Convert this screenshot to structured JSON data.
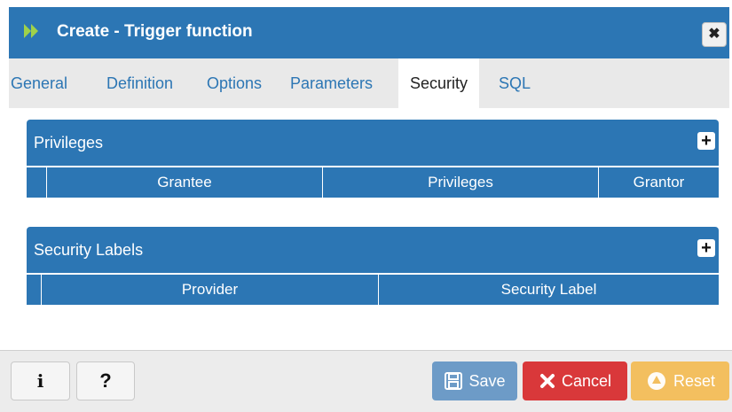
{
  "dialog": {
    "title": "Create - Trigger function",
    "close_symbol": "✖"
  },
  "tabs": [
    {
      "label": "General"
    },
    {
      "label": "Definition"
    },
    {
      "label": "Options"
    },
    {
      "label": "Parameters"
    },
    {
      "label": "Security"
    },
    {
      "label": "SQL"
    }
  ],
  "active_tab": "Security",
  "privileges": {
    "title": "Privileges",
    "add_symbol": "+",
    "columns": [
      "Grantee",
      "Privileges",
      "Grantor"
    ]
  },
  "security_labels": {
    "title": "Security Labels",
    "add_symbol": "+",
    "columns": [
      "Provider",
      "Security Label"
    ]
  },
  "footer": {
    "info_label": "i",
    "help_label": "?",
    "save_label": "Save",
    "cancel_label": "Cancel",
    "reset_label": "Reset"
  },
  "colors": {
    "primary": "#2c76b4",
    "save": "#6d9bc7",
    "cancel": "#d9383a",
    "reset": "#f3bf5f"
  }
}
